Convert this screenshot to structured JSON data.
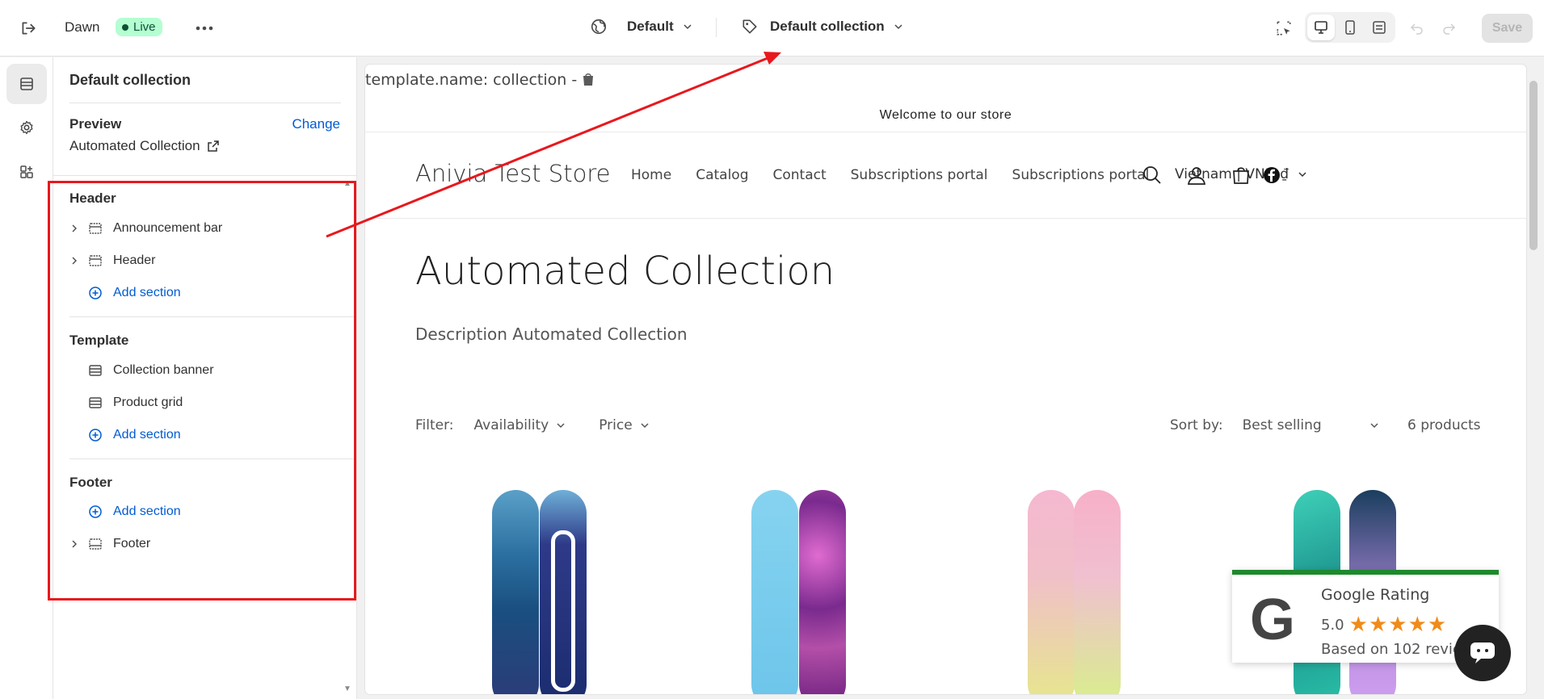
{
  "topbar": {
    "theme_name": "Dawn",
    "live_badge": "Live",
    "template_select": "Default",
    "page_select": "Default collection",
    "save_label": "Save"
  },
  "panel": {
    "title": "Default collection",
    "preview_label": "Preview",
    "change_label": "Change",
    "preview_value": "Automated Collection",
    "groups": [
      {
        "title": "Header",
        "items": [
          "Announcement bar",
          "Header"
        ],
        "add_label": "Add section"
      },
      {
        "title": "Template",
        "items": [
          "Collection banner",
          "Product grid"
        ],
        "add_label": "Add section"
      },
      {
        "title": "Footer",
        "items": [
          "Footer"
        ],
        "add_label": "Add section"
      }
    ]
  },
  "preview": {
    "template_name": "template.name: collection -",
    "announcement": "Welcome to our store",
    "store_name": "Anivia Test Store",
    "nav": [
      "Home",
      "Catalog",
      "Contact",
      "Subscriptions portal",
      "Subscriptions portal"
    ],
    "currency": "Vietnam | VND ₫",
    "collection_title": "Automated Collection",
    "collection_description": "Description Automated Collection",
    "filter_label": "Filter:",
    "filter_availability": "Availability",
    "filter_price": "Price",
    "sort_label": "Sort by:",
    "sort_value": "Best selling",
    "product_count": "6 products",
    "rating": {
      "title": "Google Rating",
      "score": "5.0",
      "stars": "★★★★★",
      "based_on": "Based on 102 revie"
    }
  },
  "colors": {
    "accent_blue": "#005bd3",
    "annotation_red": "#e8181d",
    "live_green": "#b4fed2",
    "rating_green": "#1e8a2c",
    "star_orange": "#f08b1a"
  }
}
